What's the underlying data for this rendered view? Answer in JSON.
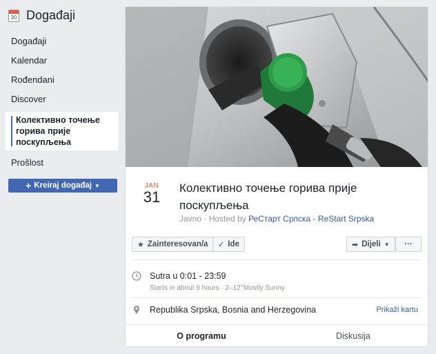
{
  "sidebar": {
    "title": "Događaji",
    "calendar_icon_day": "30",
    "items": [
      {
        "label": "Događaji"
      },
      {
        "label": "Kalendar"
      },
      {
        "label": "Rođendani"
      },
      {
        "label": "Discover"
      },
      {
        "label": "Колективно точење горива прије поскупљења"
      },
      {
        "label": "Prošlost"
      }
    ],
    "create_button": "Kreiraj događaj"
  },
  "event": {
    "month": "JAN",
    "day": "31",
    "title": "Колективно точење горива прије поскупљења",
    "privacy": "Javno",
    "hosted_prefix": "· Hosted by ",
    "host": "РеСтарт Српска - ReStart Srpska"
  },
  "actions": {
    "interested": "Zainteresovan/a",
    "going": "Ide",
    "share": "Dijeli",
    "more": "···"
  },
  "details": {
    "time": "Sutra u 0:01 - 23:59",
    "time_sub": "Starts in about 9 hours · 2–12°Mostly Sunny",
    "location": "Republika Srpska, Bosnia and Herzegovina",
    "map_link": "Prikaži kartu"
  },
  "tabs": [
    {
      "label": "O programu"
    },
    {
      "label": "Diskusija"
    }
  ],
  "colors": {
    "accent": "#4267b2",
    "date_red": "#e9573f",
    "link": "#365899"
  },
  "icons": [
    "calendar-icon",
    "plus-icon",
    "star-icon",
    "check-icon",
    "share-arrow-icon",
    "clock-icon",
    "map-pin-icon"
  ]
}
